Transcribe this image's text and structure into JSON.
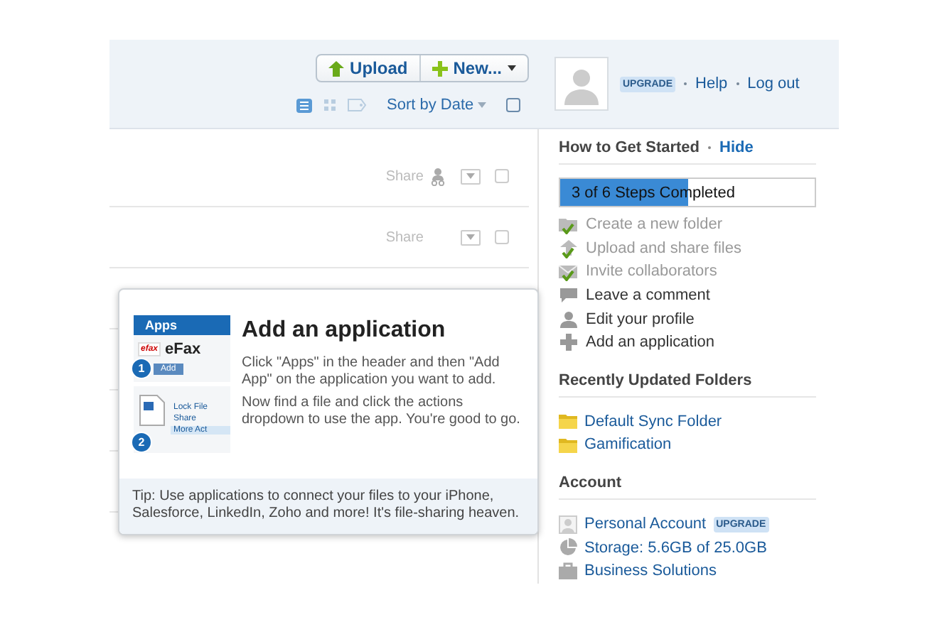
{
  "header": {
    "upload_button": "Upload",
    "new_button": "New...",
    "upgrade_badge": "UPGRADE",
    "links": [
      "Help",
      "Log out"
    ],
    "sort": "Sort by Date",
    "select_all_checked": false,
    "views": [
      {
        "kind": "list",
        "selected": true
      },
      {
        "kind": "grid",
        "selected": false
      },
      {
        "kind": "tag",
        "selected": false
      }
    ]
  },
  "files": [
    {
      "share": "Share",
      "shared": true,
      "checked": false
    },
    {
      "share": "Share",
      "shared": false,
      "checked": false
    }
  ],
  "popup": {
    "title": "Add an application",
    "paragraphs": [
      "Click \"Apps\" in the header and then \"Add App\" on the application you want to add.",
      "Now find a file and click the actions dropdown to use the app. You're good to go."
    ],
    "tip": "Tip: Use applications to connect your files to your iPhone, Salesforce, LinkedIn, Zoho and more! It's file-sharing heaven.",
    "illustration": {
      "tab": "Apps",
      "logo": "efax",
      "app": "eFax",
      "add": "Add",
      "steps": [
        "1",
        "2"
      ],
      "menu": [
        "Lock File",
        "Share",
        "More Act"
      ]
    }
  },
  "sidebar": {
    "get_started": {
      "title": "How to Get Started",
      "hide": "Hide",
      "progress": {
        "label": "3 of 6 Steps Completed",
        "level": 0.5
      },
      "steps": [
        {
          "kind": "folder",
          "label": "Create a new folder",
          "done": true
        },
        {
          "kind": "upload",
          "label": "Upload and share files",
          "done": true
        },
        {
          "kind": "invite",
          "label": "Invite collaborators",
          "done": true
        },
        {
          "kind": "comment",
          "label": "Leave a comment",
          "done": false
        },
        {
          "kind": "profile",
          "label": "Edit your profile",
          "done": false
        },
        {
          "kind": "app",
          "label": "Add an application",
          "done": false
        }
      ]
    },
    "folders": {
      "title": "Recently Updated Folders",
      "items": [
        "Default Sync Folder",
        "Gamification"
      ]
    },
    "account": {
      "title": "Account",
      "items": [
        {
          "kind": "personal",
          "label": "Personal Account",
          "badge": "UPGRADE"
        },
        {
          "kind": "storage",
          "label": "Storage: 5.6GB of 25.0GB"
        },
        {
          "kind": "business",
          "label": "Business Solutions"
        }
      ]
    }
  }
}
